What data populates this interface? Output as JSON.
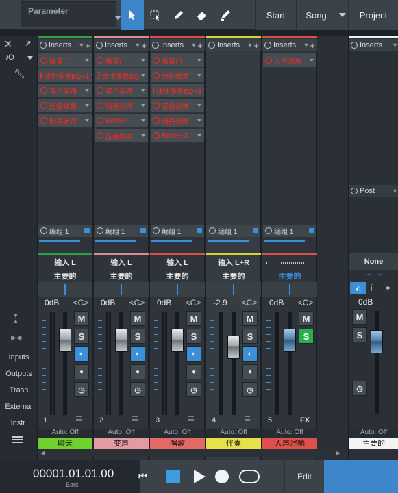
{
  "toolbar": {
    "parameter_label": "Parameter",
    "start_label": "Start",
    "song_label": "Song",
    "project_label": "Project",
    "tools": [
      "arrow-tool-icon",
      "range-tool-icon",
      "pencil-tool-icon",
      "eraser-tool-icon",
      "paint-tool-icon"
    ]
  },
  "rail": {
    "io_label": "I/O",
    "inputs": "Inputs",
    "outputs": "Outputs",
    "trash": "Trash",
    "external": "External",
    "instr": "Instr."
  },
  "channels": [
    {
      "color": "#2ea043",
      "inserts_label": "Inserts",
      "inserts": [
        "噪音门",
        "线性多量EQ+1",
        "音色润饰",
        "压缩效果",
        "明亮润饰"
      ],
      "group": "编组 1",
      "input": "输入 L",
      "output": "主要的",
      "volume": "0dB",
      "pan": "<C>",
      "number": "1",
      "auto": "Auto: Off",
      "name": "聊天",
      "name_bg": "#6fd12e",
      "name_color": "#111111"
    },
    {
      "color": "#d98a94",
      "inserts_label": "Inserts",
      "inserts": [
        "噪音门",
        "线性多量EQ",
        "音色润饰",
        "明亮润饰",
        "RoVee",
        "压缩效果"
      ],
      "group": "编组 1",
      "input": "输入 L",
      "output": "主要的",
      "volume": "0dB",
      "pan": "<C>",
      "number": "2",
      "auto": "Auto: Off",
      "name": "变声",
      "name_bg": "#e39aa3",
      "name_color": "#111111"
    },
    {
      "color": "#d9504b",
      "inserts_label": "Inserts",
      "inserts": [
        "噪音门",
        "线性效果",
        "线性多量EQ+3",
        "音色润饰",
        "明亮润饰",
        "RoVee 2"
      ],
      "group": "编组 1",
      "input": "输入 L",
      "output": "主要的",
      "volume": "0dB",
      "pan": "<C>",
      "number": "3",
      "auto": "Auto: Off",
      "name": "唱歌",
      "name_bg": "#e36a64",
      "name_color": "#111111"
    },
    {
      "color": "#d7d23a",
      "inserts_label": "Inserts",
      "inserts": [],
      "group": "编组 1",
      "input": "输入 L+R",
      "output": "主要的",
      "volume": "-2.9",
      "pan": "<C>",
      "number": "4",
      "auto": "Auto: Off",
      "name": "伴奏",
      "name_bg": "#e6e04a",
      "name_color": "#111111"
    },
    {
      "color": "#d9504b",
      "inserts_label": "Inserts",
      "inserts": [
        "人声混响"
      ],
      "group": "编组 1",
      "input": "",
      "output": "主要的",
      "volume": "0dB",
      "pan": "<C>",
      "number": "5",
      "auto": "Auto: Off",
      "name": "人声混响",
      "name_bg": "#e0504a",
      "name_color": "#111111",
      "fx": "FX"
    }
  ],
  "main_bus": {
    "inserts_label": "Inserts",
    "post_label": "Post",
    "input": "None",
    "volume": "0dB",
    "auto": "Auto: Off",
    "name": "主要的"
  },
  "buttons": {
    "mute": "M",
    "solo": "S"
  },
  "transport": {
    "time": "00001.01.01.00",
    "unit": "Bars",
    "edit_label": "Edit"
  },
  "colors": {
    "accent": "#3d8fd8",
    "insert_text": "#ff2a1f",
    "solo_active": "#2ab04a"
  }
}
